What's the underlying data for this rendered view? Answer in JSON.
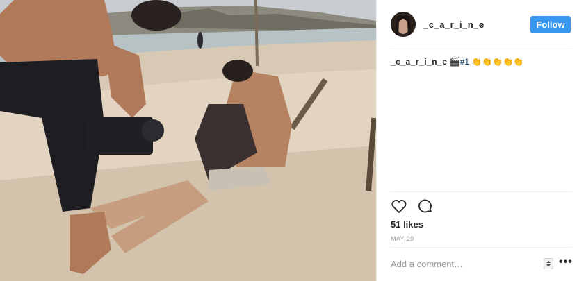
{
  "post": {
    "username": "_c_a_r_i_n_e",
    "follow_label": "Follow",
    "caption_user": "_c_a_r_i_n_e",
    "caption_emoji": "🎬",
    "caption_tag": "#1",
    "caption_trailing": "👏👏👏👏👏",
    "likes": "51 likes",
    "date": "MAY 20",
    "comment_placeholder": "Add a comment…",
    "more_label": "•••"
  },
  "icons": [
    "heart-icon",
    "comment-icon",
    "stepper-icon",
    "more-icon"
  ],
  "colors": {
    "follow": "#3897f0",
    "hashtag": "#003569",
    "muted": "#999999",
    "divider": "#efefef"
  }
}
